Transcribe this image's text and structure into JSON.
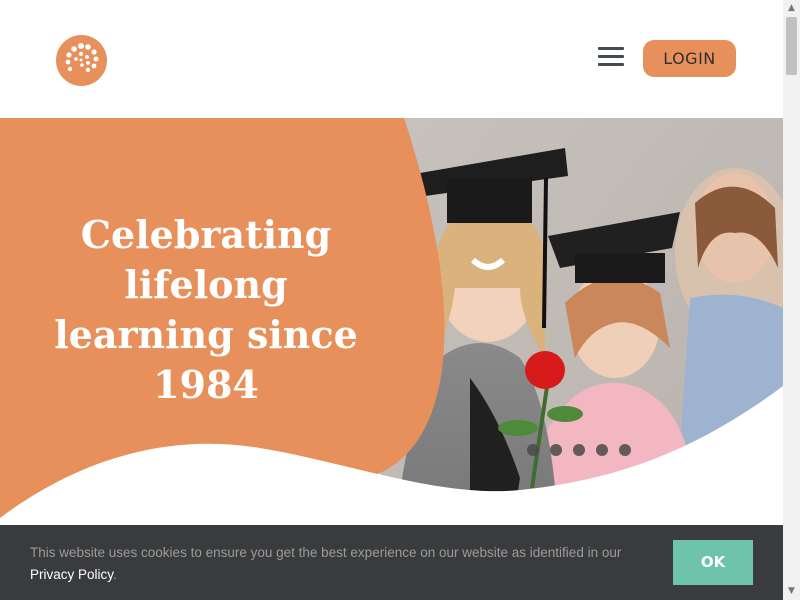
{
  "header": {
    "logo_alt": "logo",
    "login_label": "LOGIN"
  },
  "hero": {
    "headline_lines": [
      "Celebrating",
      "lifelong",
      "learning since",
      "1984"
    ],
    "slider_dots": 5
  },
  "cookie": {
    "text": "This website uses cookies to ensure you get the best experience on our website as identified in our",
    "link_label": "Privacy Policy",
    "suffix": ".",
    "ok_label": "OK"
  },
  "colors": {
    "accent": "#e8905b",
    "cookie_bg": "#3a3b3d",
    "ok_button": "#6ec3ab"
  },
  "icons": {
    "menu": "hamburger-icon",
    "logo": "spiral-dots-logo"
  }
}
